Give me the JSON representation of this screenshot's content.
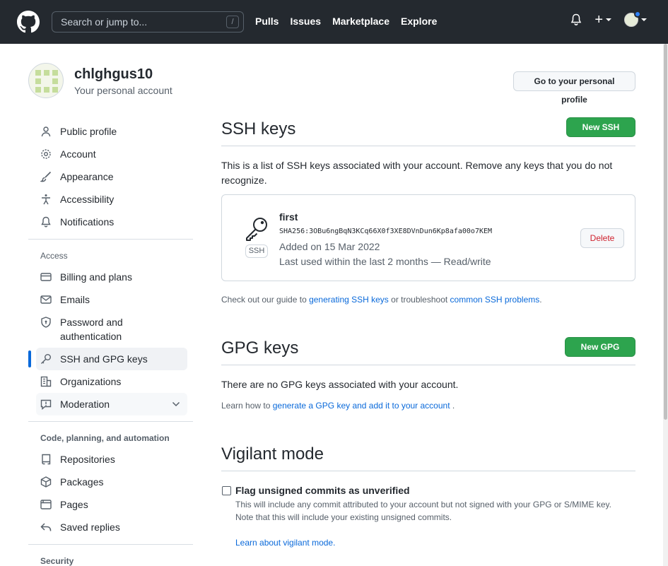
{
  "header": {
    "search_placeholder": "Search or jump to...",
    "search_shortcut": "/",
    "nav": [
      "Pulls",
      "Issues",
      "Marketplace",
      "Explore"
    ],
    "plus": "+"
  },
  "account": {
    "username": "chlghgus10",
    "subtitle": "Your personal account",
    "profile_button": "Go to your personal profile"
  },
  "sidebar": {
    "top_items": [
      {
        "label": "Public profile",
        "icon": "person-icon"
      },
      {
        "label": "Account",
        "icon": "gear-icon"
      },
      {
        "label": "Appearance",
        "icon": "paintbrush-icon"
      },
      {
        "label": "Accessibility",
        "icon": "accessibility-icon"
      },
      {
        "label": "Notifications",
        "icon": "bell-icon"
      }
    ],
    "access_heading": "Access",
    "access_items": [
      {
        "label": "Billing and plans",
        "icon": "credit-card-icon"
      },
      {
        "label": "Emails",
        "icon": "mail-icon"
      },
      {
        "label": "Password and",
        "label2": "authentication",
        "icon": "shield-lock-icon"
      },
      {
        "label": "SSH and GPG keys",
        "icon": "key-icon",
        "selected": true
      },
      {
        "label": "Organizations",
        "icon": "organization-icon"
      },
      {
        "label": "Moderation",
        "icon": "report-icon"
      }
    ],
    "code_heading": "Code, planning, and automation",
    "code_items": [
      {
        "label": "Repositories",
        "icon": "repo-icon"
      },
      {
        "label": "Packages",
        "icon": "package-icon"
      },
      {
        "label": "Pages",
        "icon": "browser-icon"
      },
      {
        "label": "Saved replies",
        "icon": "reply-icon"
      }
    ],
    "security_heading": "Security"
  },
  "ssh": {
    "title": "SSH keys",
    "new_button": "New SSH key",
    "description": "This is a list of SSH keys associated with your account. Remove any keys that you do not recognize.",
    "key": {
      "name": "first",
      "badge": "SSH",
      "fingerprint": "SHA256:3OBu6ngBqN3KCq66X0f3XE8DVnDun6Kp8afa00o7KEM",
      "added": "Added on 15 Mar 2022",
      "last_used": "Last used within the last 2 months — Read/write",
      "delete_button": "Delete"
    },
    "guide_prefix": "Check out our guide to ",
    "guide_link1": "generating SSH keys",
    "guide_middle": " or troubleshoot ",
    "guide_link2": "common SSH problems",
    "guide_suffix": "."
  },
  "gpg": {
    "title": "GPG keys",
    "new_button": "New GPG key",
    "empty": "There are no GPG keys associated with your account.",
    "learn_prefix": "Learn how to ",
    "learn_link": "generate a GPG key and add it to your account",
    "learn_suffix": " ."
  },
  "vigilant": {
    "title": "Vigilant mode",
    "checkbox_label": "Flag unsigned commits as unverified",
    "description1": "This will include any commit attributed to your account but not signed with your GPG or S/MIME key.",
    "description2": "Note that this will include your existing unsigned commits.",
    "learn_link": "Learn about vigilant mode."
  }
}
